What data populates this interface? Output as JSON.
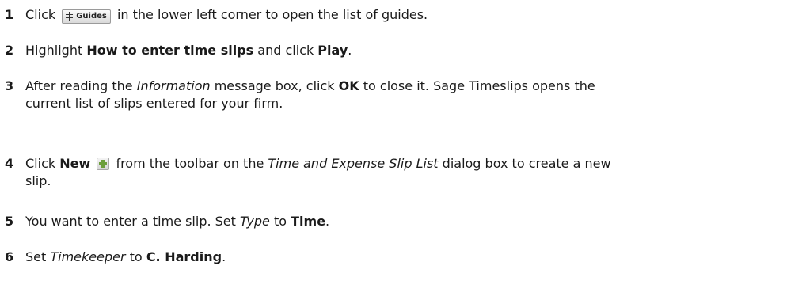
{
  "steps": [
    {
      "number": "1",
      "text_before": "Click",
      "button_label": "Guides",
      "text_after": "in the lower left corner to open the list of guides."
    },
    {
      "number": "2",
      "text_before": "Highlight",
      "bold1": "How to enter time slips",
      "text_middle": "and click",
      "bold2": "Play",
      "text_end": "."
    },
    {
      "number": "3",
      "text_before": "After reading the",
      "italic1": "Information",
      "text_middle": "message box, click",
      "bold1": "OK",
      "text_after": "to close it. Sage Timeslips opens the",
      "line2": "current list of slips entered for your firm."
    },
    {
      "number": "4",
      "text_before": "Click",
      "bold1": "New",
      "text_middle": "from the toolbar on the",
      "italic1": "Time and Expense Slip List",
      "text_after": "dialog box to create a new",
      "line2": "slip."
    },
    {
      "number": "5",
      "text_before": "You want to enter a time slip. Set",
      "italic1": "Type",
      "text_middle": "to",
      "bold1": "Time",
      "text_end": "."
    },
    {
      "number": "6",
      "text_before": "Set",
      "italic1": "Timekeeper",
      "text_middle": "to",
      "bold1": "C. Harding",
      "text_end": "."
    }
  ],
  "icons": {
    "guides": "guides-icon",
    "new": "new-plus-icon",
    "new_color": "#6c9e3c"
  }
}
